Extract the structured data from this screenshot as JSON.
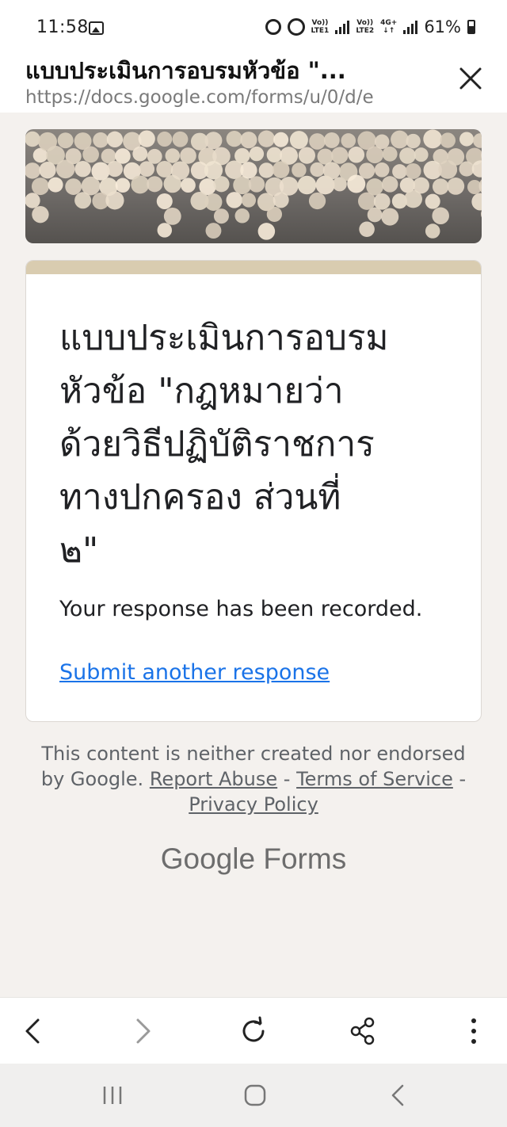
{
  "status_bar": {
    "time": "11:58",
    "battery": "61%",
    "network1_top": "Vo))",
    "network1_bottom": "LTE1",
    "network2_top": "Vo))",
    "network2_bottom": "LTE2",
    "network3_top": "4G+"
  },
  "browser": {
    "page_title": "แบบประเมินการอบรมหัวข้อ \"...",
    "url": "https://docs.google.com/forms/u/0/d/e"
  },
  "form": {
    "title": "แบบประเมินการอบรมหัวข้อ \"กฎหมายว่าด้วยวิธีปฏิบัติราชการทางปกครอง ส่วนที่ ๒\"",
    "title_line1": "แบบประเมินการอบรม",
    "title_line2": "หัวข้อ \"กฎหมายว่า",
    "title_line3": "ด้วยวิธีปฏิบัติราชการ",
    "title_line4": "ทางปกครอง ส่วนที่",
    "title_line5": "๒\"",
    "confirmation": "Your response has been recorded.",
    "submit_another": "Submit another response",
    "accent_color": "#d9ccb0"
  },
  "footer": {
    "notice_text": "This content is neither created nor endorsed by Google.",
    "report_abuse": "Report Abuse",
    "sep1": " - ",
    "terms": "Terms of Service",
    "sep2": " - ",
    "privacy": "Privacy Policy",
    "logo_text": "Google Forms"
  },
  "icons": {
    "close": "close-icon",
    "back": "chevron-left-icon",
    "forward": "chevron-right-icon",
    "reload": "reload-icon",
    "share": "share-icon",
    "menu": "more-vert-icon",
    "recents": "recents-icon",
    "home": "home-icon",
    "system_back": "system-back-icon"
  }
}
